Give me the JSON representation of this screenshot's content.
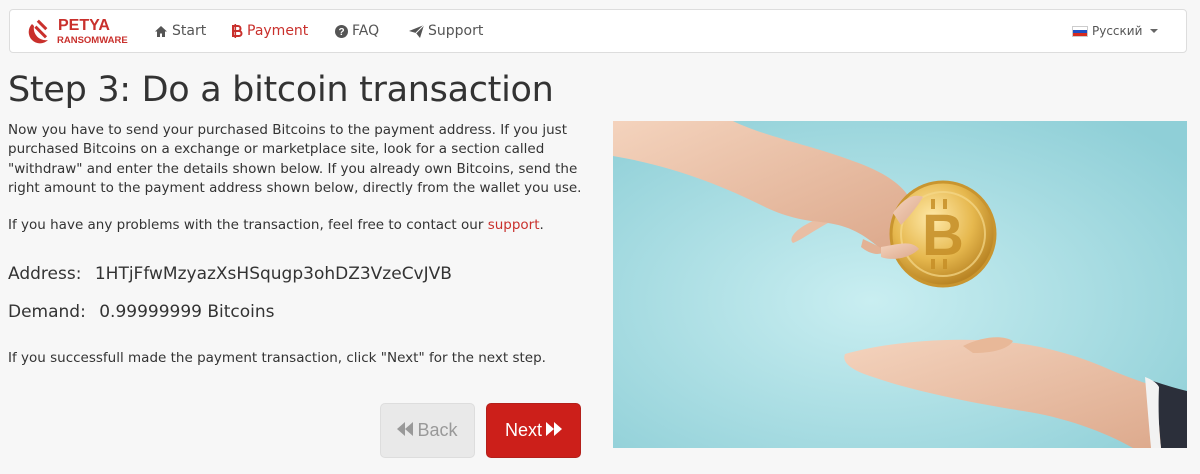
{
  "nav": {
    "brand_line1": "PETYA",
    "brand_line2": "RANSOMWARE",
    "start": "Start",
    "payment": "Payment",
    "faq": "FAQ",
    "support": "Support",
    "language": "Русский"
  },
  "main": {
    "title": "Step 3: Do a bitcoin transaction",
    "intro": "Now you have to send your purchased Bitcoins to the payment address. If you just purchased Bitcoins on a exchange or marketplace site, look for a section called \"withdraw\" and enter the details shown below. If you already own Bitcoins, send the right amount to the payment address shown below, directly from the wallet you use.",
    "problems_prefix": "If you have any problems with the transaction, feel free to contact our ",
    "problems_link": "support",
    "problems_suffix": ".",
    "address_label": "Address:",
    "address_value": "1HTjFfwMzyazXsHSqugp3ohDZ3VzeCvJVB",
    "demand_label": "Demand:",
    "demand_value": "0.99999999 Bitcoins",
    "next_hint": "If you successfull made the payment transaction, click \"Next\" for the next step."
  },
  "buttons": {
    "back": "Back",
    "next": "Next"
  },
  "colors": {
    "accent": "#cc1f1a",
    "hero_bg": "#a8dbe0"
  }
}
